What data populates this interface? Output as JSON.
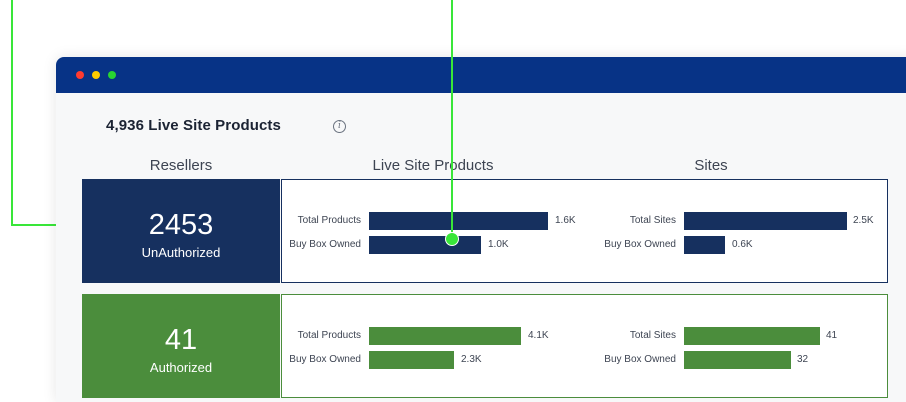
{
  "page": {
    "title": "4,936 Live Site Products",
    "info_icon": "info-icon",
    "info_glyph": "i"
  },
  "columns": {
    "resellers": "Resellers",
    "live_site_products": "Live Site Products",
    "sites": "Sites"
  },
  "colors": {
    "titlebar": "#073386",
    "unauthorized": "#16305f",
    "authorized": "#4b8d3c",
    "callout": "#39e639"
  },
  "rows": [
    {
      "key": "unauth",
      "count": "2453",
      "label": "UnAuthorized",
      "products": [
        {
          "label": "Total Products",
          "value": "1.6K",
          "amount": 1.6
        },
        {
          "label": "Buy Box Owned",
          "value": "1.0K",
          "amount": 1.0
        }
      ],
      "sites": [
        {
          "label": "Total Sites",
          "value": "2.5K",
          "amount": 2.5
        },
        {
          "label": "Buy Box Owned",
          "value": "0.6K",
          "amount": 0.6
        }
      ]
    },
    {
      "key": "auth",
      "count": "41",
      "label": "Authorized",
      "products": [
        {
          "label": "Total Products",
          "value": "4.1K",
          "amount": 4.1
        },
        {
          "label": "Buy Box Owned",
          "value": "2.3K",
          "amount": 2.3
        }
      ],
      "sites": [
        {
          "label": "Total Sites",
          "value": "41",
          "amount": 41
        },
        {
          "label": "Buy Box Owned",
          "value": "32",
          "amount": 32
        }
      ]
    }
  ]
}
